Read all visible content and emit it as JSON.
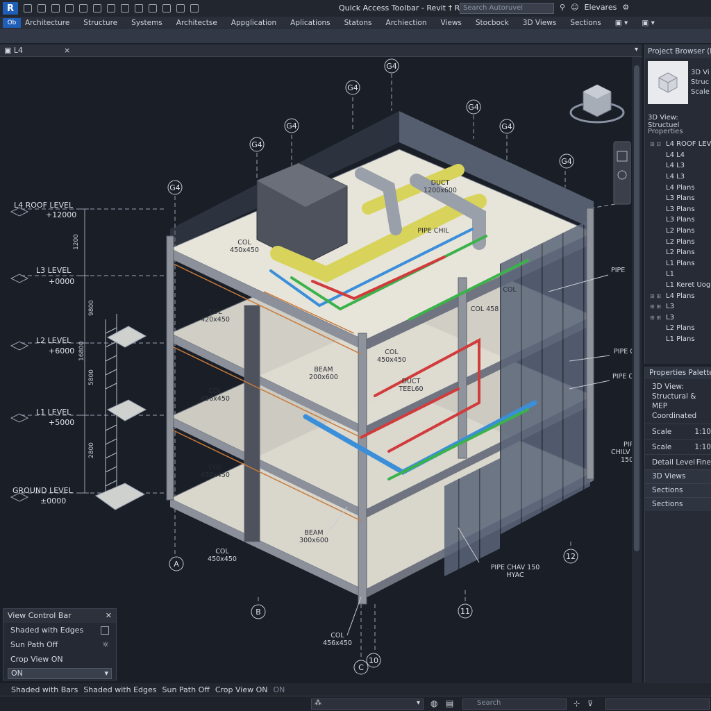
{
  "app": {
    "logo": "R",
    "title": "Quick Access Toolbar - Revit † Rewert",
    "search_placeholder": "Search Autoruvel",
    "user": "Elevares"
  },
  "ribbon": {
    "file_label": "Ob",
    "tabs": [
      "Architecture",
      "Structure",
      "Systems",
      "Architectse",
      "Appglication",
      "Aplications",
      "Statons",
      "Archiection",
      "Views",
      "Stocbock",
      "3D Views",
      "Sections"
    ]
  },
  "view_tab": {
    "label": "L4",
    "close": "×"
  },
  "levels": [
    {
      "name": "L4 ROOF LEVEL",
      "elev": "+12000"
    },
    {
      "name": "L3 LEVEL",
      "elev": "+0000"
    },
    {
      "name": "L2 LEVEL",
      "elev": "+6000"
    },
    {
      "name": "L1 LEVEL",
      "elev": "+5000"
    },
    {
      "name": "GROUND LEVEL",
      "elev": "±0000"
    }
  ],
  "dims": [
    "1200",
    "9800",
    "16800",
    "5800",
    "2800"
  ],
  "grid_bubbles": {
    "top": [
      "G4",
      "G4",
      "G4",
      "G4",
      "G4",
      "G4",
      "G4"
    ],
    "bottom": [
      "A",
      "B",
      "C",
      "10",
      "11",
      "12"
    ]
  },
  "annotations": {
    "duct1": "DUCT",
    "duct1_size": "1200x600",
    "col1": "COL",
    "col1_size": "450x450",
    "col2": "COL",
    "col2_size": "420x450",
    "col3": "COL",
    "col3_size": "450x450",
    "col4": "COL",
    "col4_size": "456x450",
    "col5": "COL",
    "col5_size": "456x450",
    "col6": "COL",
    "col6_size": "450x450",
    "col7": "COL",
    "col7_size": "456x450",
    "col_glass": "COL",
    "col_glass2": "COL 458",
    "beam1": "BEAM",
    "beam1_size": "200x600",
    "beam2": "BEAM",
    "beam2_size": "300x600",
    "duct2": "DUCT",
    "duct2_size": "TEEL60",
    "pipe_chil": "PIPE CHIL",
    "pipe_r1": "PIPE",
    "pipe_r2": "PIPE C",
    "pipe_r3": "PIPE C",
    "pipe_r4": "PIPE",
    "pipe_r4b": "CHILV",
    "pipe_r4c": "150",
    "pipe_hvac": "PIPE CHAV 150",
    "pipe_hvac2": "HYAC"
  },
  "project_browser": {
    "header": "Project Browser (L",
    "thumb_lines": [
      "3D Vi",
      "Struc",
      "Scale"
    ],
    "view": "3D View: Structuel",
    "properties": "Properties",
    "tree": [
      {
        "toggle": "⊞ ⊟",
        "label": "L4 ROOF LEV"
      },
      {
        "toggle": "",
        "label": "L4 L4"
      },
      {
        "toggle": "",
        "label": "L4 L3"
      },
      {
        "toggle": "",
        "label": "L4 L3"
      },
      {
        "toggle": "",
        "label": "L4 Plans"
      },
      {
        "toggle": "",
        "label": "L3 Plans"
      },
      {
        "toggle": "",
        "label": "L3 Plans"
      },
      {
        "toggle": "",
        "label": "L3 Plans"
      },
      {
        "toggle": "",
        "label": "L2 Plans"
      },
      {
        "toggle": "",
        "label": "L2 Plans"
      },
      {
        "toggle": "",
        "label": "L2 Plans"
      },
      {
        "toggle": "",
        "label": "L1 Plans"
      },
      {
        "toggle": "",
        "label": "L1"
      },
      {
        "toggle": "",
        "label": "L1 Keret Uog"
      },
      {
        "toggle": "⊞ ⊞",
        "label": "L4 Plans"
      },
      {
        "toggle": "⊞ ⊞",
        "label": "L3"
      },
      {
        "toggle": "⊞ ⊞",
        "label": "L3"
      },
      {
        "toggle": "",
        "label": "L2 Plans"
      },
      {
        "toggle": "",
        "label": "L1 Plans"
      }
    ]
  },
  "properties_palette": {
    "header": "Properties Palette",
    "view_name": "3D View:",
    "view_line2": "Structural & MEP",
    "view_line3": "Coordinated",
    "rows": [
      {
        "key": "Scale",
        "value": "1:10"
      },
      {
        "key": "Scale",
        "value": "1:10"
      },
      {
        "key": "Detail Level",
        "value": "Fine"
      }
    ],
    "sections": [
      "3D Views",
      "Sections",
      "Sections"
    ]
  },
  "view_control_bar": {
    "header": "View Control Bar",
    "rows": [
      "Shaded with Edges",
      "Sun Path Off",
      "Crop View ON"
    ],
    "select_value": "ON"
  },
  "status_bar": {
    "items": [
      "Shaded with Bars",
      "Shaded with Edges",
      "Sun Path Off",
      "Crop View ON"
    ],
    "extra": "ON"
  },
  "bottom": {
    "search_placeholder": "Search"
  },
  "colors": {
    "duct": "#d8d35a",
    "pipe_blue": "#3b8fd9",
    "pipe_red": "#d23b3b",
    "pipe_green": "#3bb24a",
    "slab": "#e7e4da",
    "accent": "#1f5fb8"
  }
}
